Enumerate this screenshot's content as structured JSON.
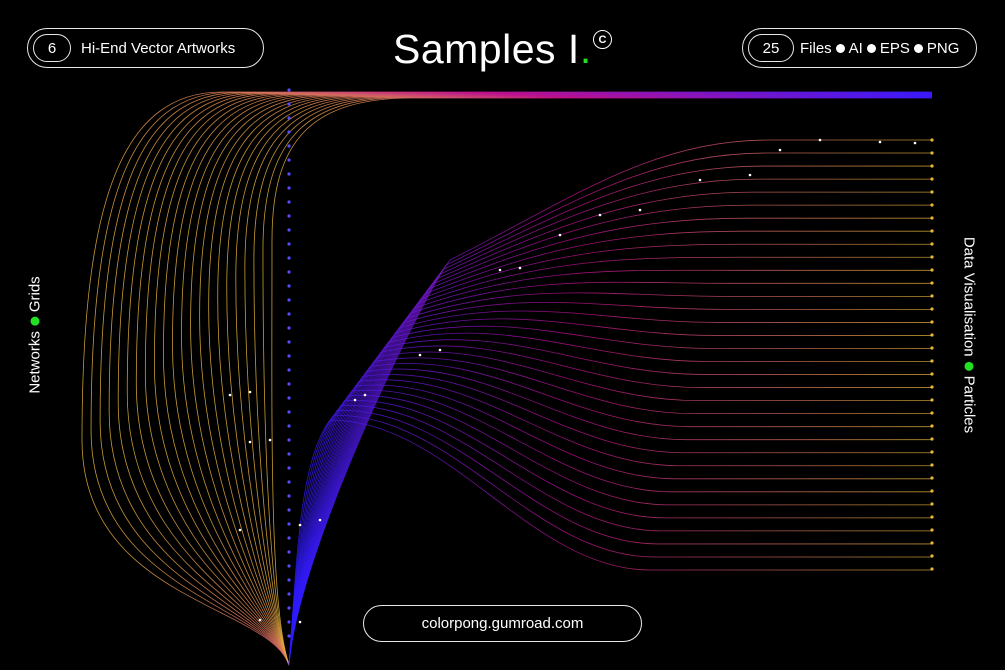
{
  "header": {
    "left_badge": {
      "count": "6",
      "label": "Hi-End Vector Artworks"
    },
    "title": {
      "text": "Samples I",
      "period": "."
    },
    "right_badge": {
      "count": "25",
      "formats": [
        "Files",
        "AI",
        "EPS",
        "PNG"
      ]
    }
  },
  "side": {
    "left": {
      "part1": "Networks",
      "part2": "Grids"
    },
    "right": {
      "part1": "Data Visualisation",
      "part2": "Particles"
    }
  },
  "footer": {
    "url": "colorpong.gumroad.com"
  },
  "colors": {
    "background": "#000000",
    "accent_dot": "#22e022",
    "gradient": [
      "#2a1aff",
      "#c0108e",
      "#e8b83a"
    ]
  },
  "icons": {
    "copyright": "copyright-icon"
  }
}
